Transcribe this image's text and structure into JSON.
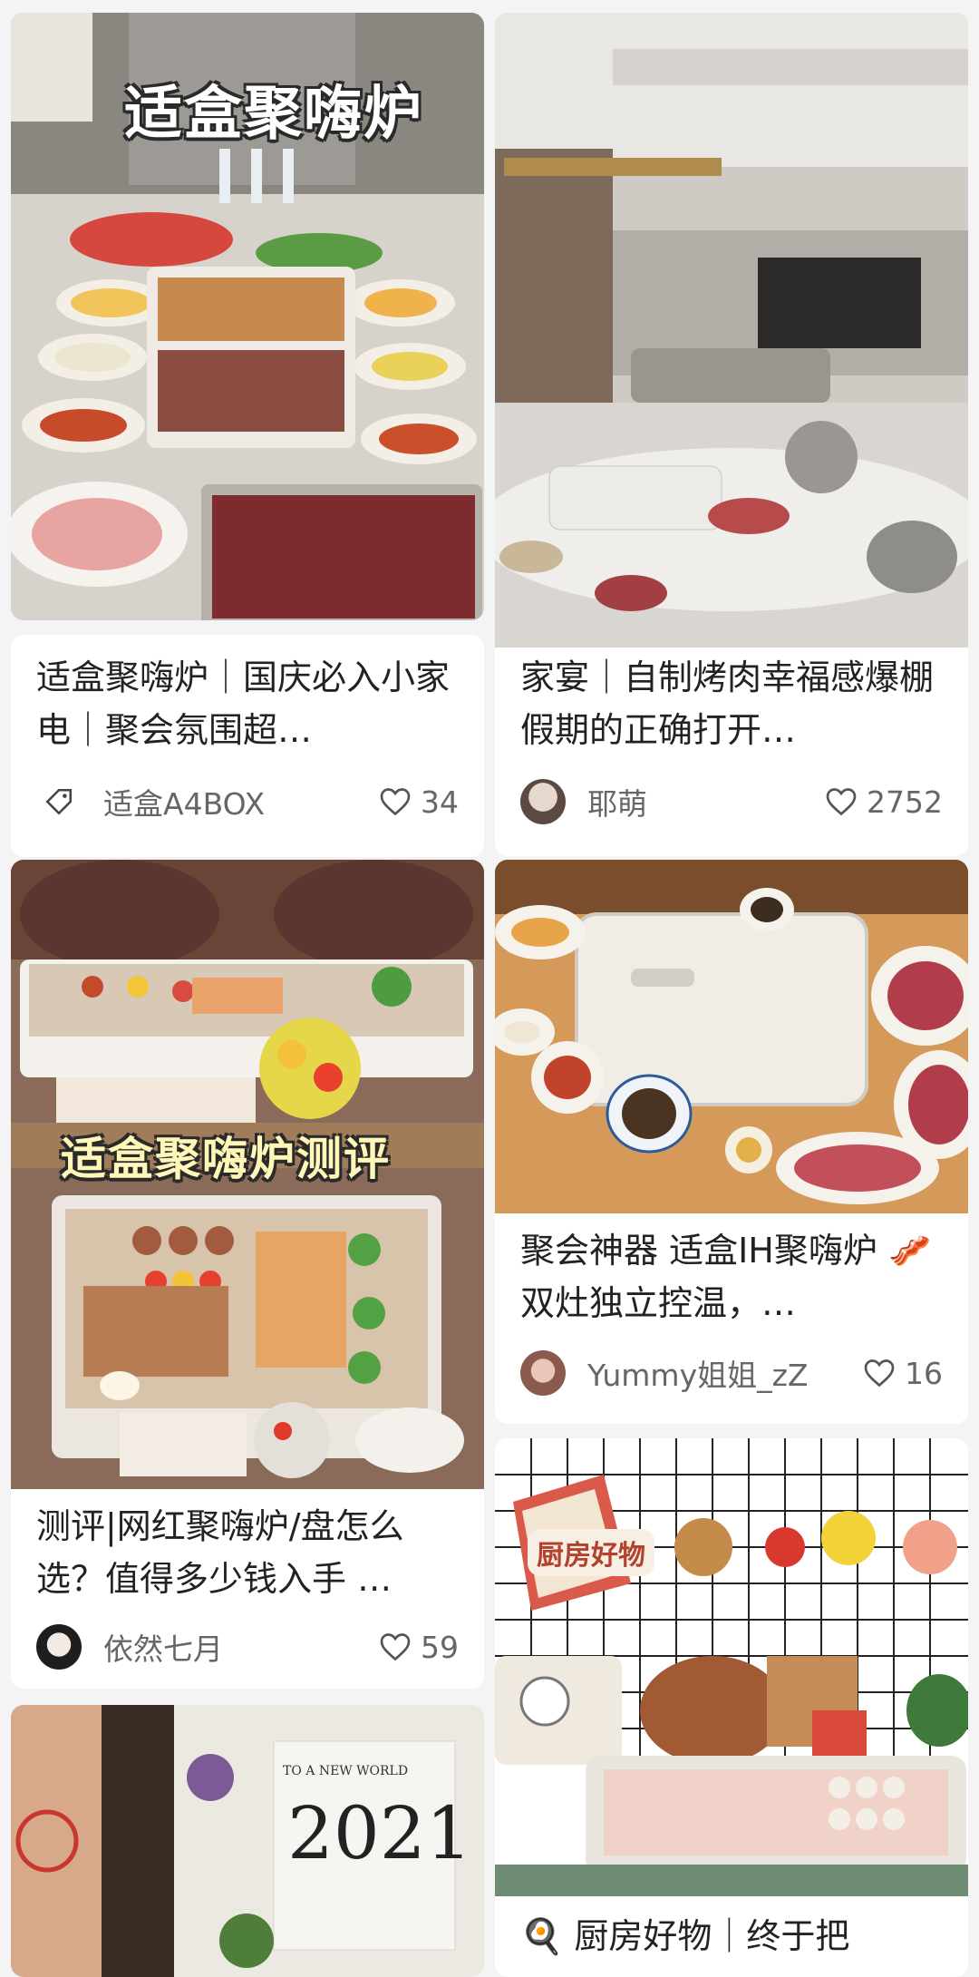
{
  "feed": {
    "cards": [
      {
        "image_label": "适盒聚嗨炉",
        "title": "适盒聚嗨炉｜国庆必入小家电｜聚会氛围超…",
        "author": "适盒A4BOX",
        "likes": "34"
      },
      {
        "title": "家宴｜自制烤肉幸福感爆棚 假期的正确打开…",
        "author": "耶萌",
        "likes": "2752"
      },
      {
        "image_label": "适盒聚嗨炉测评",
        "title": "测评|网红聚嗨炉/盘怎么选？值得多少钱入手 …",
        "author": "依然七月",
        "likes": "59"
      },
      {
        "title": "聚会神器 适盒IH聚嗨炉 🥓双灶独立控温，…",
        "author": "Yummy姐姐_zZ",
        "likes": "16"
      },
      {
        "image_label": "2021",
        "image_caption": "TO A NEW WORLD"
      },
      {
        "image_label": "厨房好物",
        "title": "🍳 厨房好物｜终于把"
      }
    ]
  },
  "colors": {
    "background": "#f4f4f4",
    "card": "#ffffff",
    "text_primary": "#222222",
    "text_secondary": "#666666",
    "heart_outline": "#555555"
  },
  "icons": {
    "like": "heart-outline-icon",
    "brand_avatar": "tag-icon"
  }
}
